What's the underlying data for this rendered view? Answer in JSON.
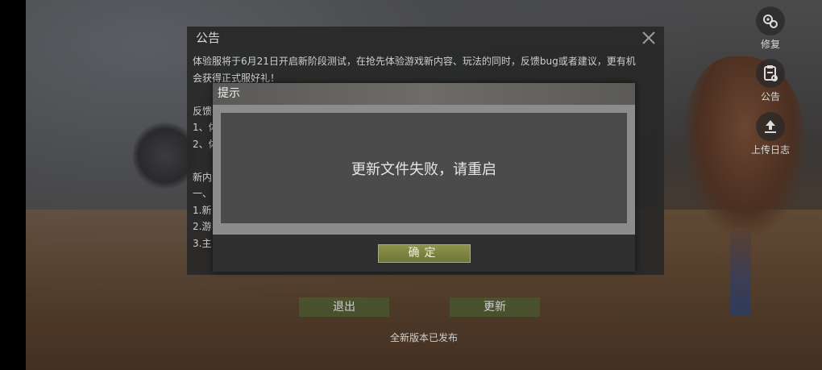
{
  "notice": {
    "title": "公告",
    "lines": [
      "体验服将于6月21日开启新阶段测试，在抢先体验游戏新内容、玩法的同时，反馈bug或者建议，更有机",
      "会获得正式服好礼！",
      "",
      "反馈",
      "1、体",
      "2、体",
      "",
      "新内",
      "一、",
      "1.新",
      "2.游",
      "3.主"
    ]
  },
  "tools": [
    {
      "label": "修复",
      "icon": "repair-gear-icon"
    },
    {
      "label": "公告",
      "icon": "clipboard-icon"
    },
    {
      "label": "上传日志",
      "icon": "upload-icon"
    }
  ],
  "bottom": {
    "exit_label": "退出",
    "update_label": "更新",
    "release_text": "全新版本已发布"
  },
  "dialog": {
    "title": "提示",
    "message": "更新文件失败，请重启",
    "confirm_label": "确定"
  }
}
